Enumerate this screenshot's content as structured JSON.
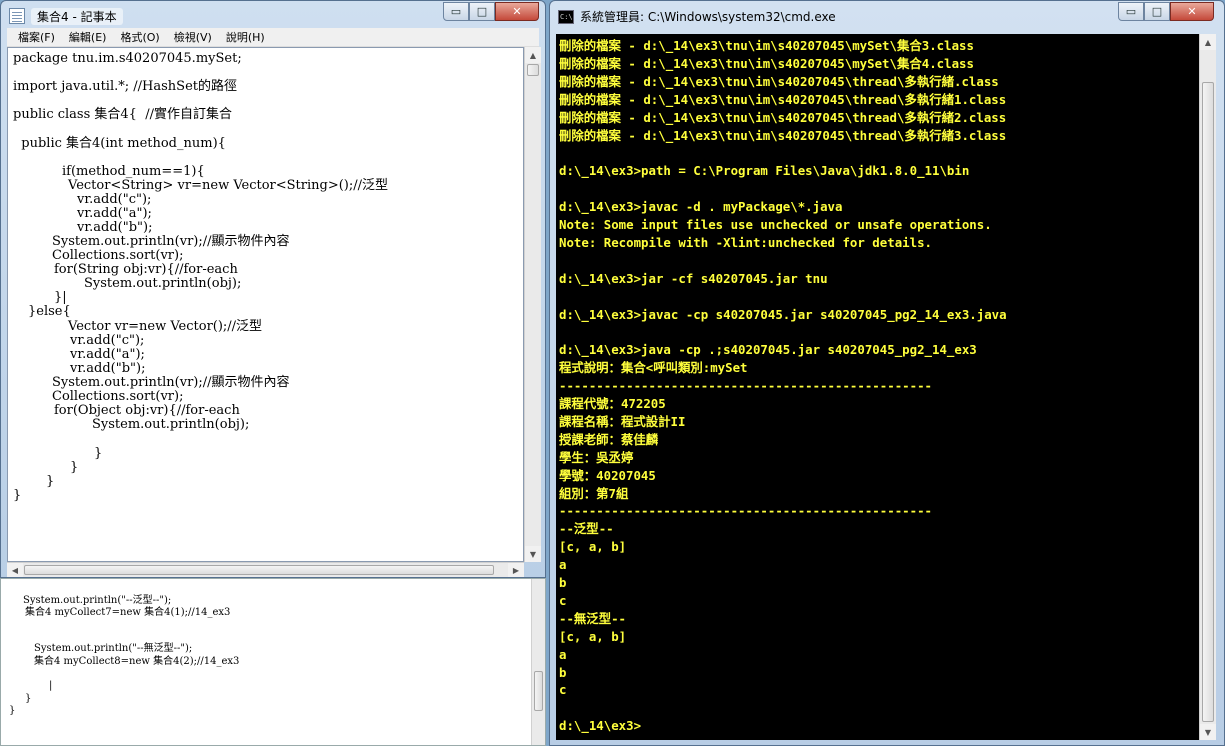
{
  "notepad": {
    "title": "集合4 - 記事本",
    "menu": [
      "檔案(F)",
      "編輯(E)",
      "格式(O)",
      "檢視(V)",
      "說明(H)"
    ],
    "lines": [
      "package tnu.im.s40207045.mySet;",
      "import java.util.*; //HashSet的路徑",
      "public class 集合4{  //實作自訂集合",
      "  public 集合4(int method_num){",
      "if(method_num==1){",
      "Vector<String> vr=new Vector<String>();//泛型",
      "vr.add(\"c\");",
      "vr.add(\"a\");",
      "vr.add(\"b\");",
      "System.out.println(vr);//顯示物件內容",
      "Collections.sort(vr);",
      "for(String obj:vr){//for-each",
      "System.out.println(obj);",
      "}|",
      "}else{",
      "Vector vr=new Vector();//泛型",
      "vr.add(\"c\");",
      "vr.add(\"a\");",
      "vr.add(\"b\");",
      "System.out.println(vr);//顯示物件內容",
      "Collections.sort(vr);",
      "for(Object obj:vr){//for-each",
      "System.out.println(obj);",
      "}",
      "}",
      "}",
      "}"
    ]
  },
  "lower_pane": {
    "lines": [
      "System.out.println(\"--泛型--\");",
      "集合4 myCollect7=new 集合4(1);//14_ex3",
      "System.out.println(\"--無泛型--\");",
      "集合4 myCollect8=new 集合4(2);//14_ex3",
      "|",
      "}",
      "}"
    ]
  },
  "cmd": {
    "title": "系統管理員: C:\\Windows\\system32\\cmd.exe",
    "icon_text": "C:\\",
    "text_color": "#ffff3c",
    "background": "#000000",
    "lines": [
      "刪除的檔案 - d:\\_14\\ex3\\tnu\\im\\s40207045\\mySet\\集合3.class",
      "刪除的檔案 - d:\\_14\\ex3\\tnu\\im\\s40207045\\mySet\\集合4.class",
      "刪除的檔案 - d:\\_14\\ex3\\tnu\\im\\s40207045\\thread\\多執行緒.class",
      "刪除的檔案 - d:\\_14\\ex3\\tnu\\im\\s40207045\\thread\\多執行緒1.class",
      "刪除的檔案 - d:\\_14\\ex3\\tnu\\im\\s40207045\\thread\\多執行緒2.class",
      "刪除的檔案 - d:\\_14\\ex3\\tnu\\im\\s40207045\\thread\\多執行緒3.class",
      "",
      "d:\\_14\\ex3>path = C:\\Program Files\\Java\\jdk1.8.0_11\\bin",
      "",
      "d:\\_14\\ex3>javac -d . myPackage\\*.java",
      "Note: Some input files use unchecked or unsafe operations.",
      "Note: Recompile with -Xlint:unchecked for details.",
      "",
      "d:\\_14\\ex3>jar -cf s40207045.jar tnu",
      "",
      "d:\\_14\\ex3>javac -cp s40207045.jar s40207045_pg2_14_ex3.java",
      "",
      "d:\\_14\\ex3>java -cp .;s40207045.jar s40207045_pg2_14_ex3",
      "程式說明：集合<呼叫類別:mySet",
      "--------------------------------------------------",
      "課程代號：472205",
      "課程名稱：程式設計II",
      "授課老師：蔡佳麟",
      "學生：吳丞婷",
      "學號：40207045",
      "組別：第7組",
      "--------------------------------------------------",
      "--泛型--",
      "[c, a, b]",
      "a",
      "b",
      "c",
      "--無泛型--",
      "[c, a, b]",
      "a",
      "b",
      "c",
      "",
      "d:\\_14\\ex3>"
    ]
  },
  "caption": {
    "minimize": "▭",
    "maximize": "□",
    "close": "✕"
  }
}
